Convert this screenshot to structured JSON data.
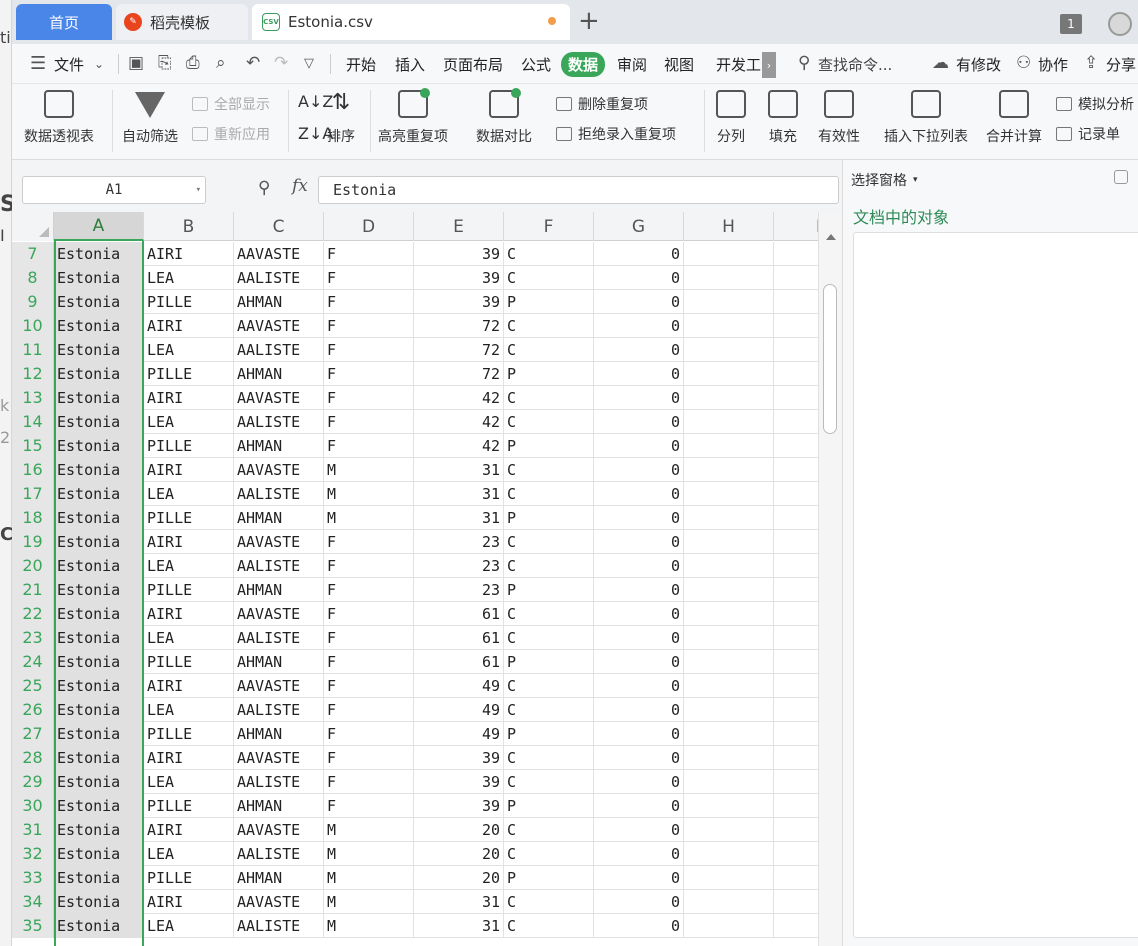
{
  "background": {
    "peek_chars": [
      "ti",
      "S",
      "I",
      "k",
      "2",
      "C"
    ]
  },
  "tabs": {
    "home": "首页",
    "template": "稻壳模板",
    "csv": "Estonia.csv",
    "csv_icon": "CSV",
    "plus": "+",
    "window_count": "1"
  },
  "menu": {
    "file": "文件",
    "items": [
      "开始",
      "插入",
      "页面布局",
      "公式",
      "数据",
      "审阅",
      "视图",
      "开发工"
    ],
    "active": "数据",
    "search": "查找命令...",
    "modified": "有修改",
    "collab": "协作",
    "share": "分享"
  },
  "ribbon": {
    "pivot": "数据透视表",
    "autofilter": "自动筛选",
    "show_all": "全部显示",
    "reapply": "重新应用",
    "sort": "排序",
    "highlight_dup": "高亮重复项",
    "compare": "数据对比",
    "remove_dup": "删除重复项",
    "reject_dup": "拒绝录入重复项",
    "split": "分列",
    "fill": "填充",
    "validity": "有效性",
    "insert_dropdown": "插入下拉列表",
    "consolidate": "合并计算",
    "whatif": "模拟分析",
    "record": "记录单"
  },
  "formula_bar": {
    "name_box": "A1",
    "fx": "fx",
    "value": "Estonia"
  },
  "columns": [
    "A",
    "B",
    "C",
    "D",
    "E",
    "F",
    "G",
    "H",
    "I"
  ],
  "rows": [
    {
      "n": "7",
      "a": "Estonia",
      "b": "AIRI",
      "c": "AAVASTE",
      "d": "F",
      "e": "39",
      "f": "C",
      "g": "0"
    },
    {
      "n": "8",
      "a": "Estonia",
      "b": "LEA",
      "c": "AALISTE",
      "d": "F",
      "e": "39",
      "f": "C",
      "g": "0"
    },
    {
      "n": "9",
      "a": "Estonia",
      "b": "PILLE",
      "c": "AHMAN",
      "d": "F",
      "e": "39",
      "f": "P",
      "g": "0"
    },
    {
      "n": "10",
      "a": "Estonia",
      "b": "AIRI",
      "c": "AAVASTE",
      "d": "F",
      "e": "72",
      "f": "C",
      "g": "0"
    },
    {
      "n": "11",
      "a": "Estonia",
      "b": "LEA",
      "c": "AALISTE",
      "d": "F",
      "e": "72",
      "f": "C",
      "g": "0"
    },
    {
      "n": "12",
      "a": "Estonia",
      "b": "PILLE",
      "c": "AHMAN",
      "d": "F",
      "e": "72",
      "f": "P",
      "g": "0"
    },
    {
      "n": "13",
      "a": "Estonia",
      "b": "AIRI",
      "c": "AAVASTE",
      "d": "F",
      "e": "42",
      "f": "C",
      "g": "0"
    },
    {
      "n": "14",
      "a": "Estonia",
      "b": "LEA",
      "c": "AALISTE",
      "d": "F",
      "e": "42",
      "f": "C",
      "g": "0"
    },
    {
      "n": "15",
      "a": "Estonia",
      "b": "PILLE",
      "c": "AHMAN",
      "d": "F",
      "e": "42",
      "f": "P",
      "g": "0"
    },
    {
      "n": "16",
      "a": "Estonia",
      "b": "AIRI",
      "c": "AAVASTE",
      "d": "M",
      "e": "31",
      "f": "C",
      "g": "0"
    },
    {
      "n": "17",
      "a": "Estonia",
      "b": "LEA",
      "c": "AALISTE",
      "d": "M",
      "e": "31",
      "f": "C",
      "g": "0"
    },
    {
      "n": "18",
      "a": "Estonia",
      "b": "PILLE",
      "c": "AHMAN",
      "d": "M",
      "e": "31",
      "f": "P",
      "g": "0"
    },
    {
      "n": "19",
      "a": "Estonia",
      "b": "AIRI",
      "c": "AAVASTE",
      "d": "F",
      "e": "23",
      "f": "C",
      "g": "0"
    },
    {
      "n": "20",
      "a": "Estonia",
      "b": "LEA",
      "c": "AALISTE",
      "d": "F",
      "e": "23",
      "f": "C",
      "g": "0"
    },
    {
      "n": "21",
      "a": "Estonia",
      "b": "PILLE",
      "c": "AHMAN",
      "d": "F",
      "e": "23",
      "f": "P",
      "g": "0"
    },
    {
      "n": "22",
      "a": "Estonia",
      "b": "AIRI",
      "c": "AAVASTE",
      "d": "F",
      "e": "61",
      "f": "C",
      "g": "0"
    },
    {
      "n": "23",
      "a": "Estonia",
      "b": "LEA",
      "c": "AALISTE",
      "d": "F",
      "e": "61",
      "f": "C",
      "g": "0"
    },
    {
      "n": "24",
      "a": "Estonia",
      "b": "PILLE",
      "c": "AHMAN",
      "d": "F",
      "e": "61",
      "f": "P",
      "g": "0"
    },
    {
      "n": "25",
      "a": "Estonia",
      "b": "AIRI",
      "c": "AAVASTE",
      "d": "F",
      "e": "49",
      "f": "C",
      "g": "0"
    },
    {
      "n": "26",
      "a": "Estonia",
      "b": "LEA",
      "c": "AALISTE",
      "d": "F",
      "e": "49",
      "f": "C",
      "g": "0"
    },
    {
      "n": "27",
      "a": "Estonia",
      "b": "PILLE",
      "c": "AHMAN",
      "d": "F",
      "e": "49",
      "f": "P",
      "g": "0"
    },
    {
      "n": "28",
      "a": "Estonia",
      "b": "AIRI",
      "c": "AAVASTE",
      "d": "F",
      "e": "39",
      "f": "C",
      "g": "0"
    },
    {
      "n": "29",
      "a": "Estonia",
      "b": "LEA",
      "c": "AALISTE",
      "d": "F",
      "e": "39",
      "f": "C",
      "g": "0"
    },
    {
      "n": "30",
      "a": "Estonia",
      "b": "PILLE",
      "c": "AHMAN",
      "d": "F",
      "e": "39",
      "f": "P",
      "g": "0"
    },
    {
      "n": "31",
      "a": "Estonia",
      "b": "AIRI",
      "c": "AAVASTE",
      "d": "M",
      "e": "20",
      "f": "C",
      "g": "0"
    },
    {
      "n": "32",
      "a": "Estonia",
      "b": "LEA",
      "c": "AALISTE",
      "d": "M",
      "e": "20",
      "f": "C",
      "g": "0"
    },
    {
      "n": "33",
      "a": "Estonia",
      "b": "PILLE",
      "c": "AHMAN",
      "d": "M",
      "e": "20",
      "f": "P",
      "g": "0"
    },
    {
      "n": "34",
      "a": "Estonia",
      "b": "AIRI",
      "c": "AAVASTE",
      "d": "M",
      "e": "31",
      "f": "C",
      "g": "0"
    },
    {
      "n": "35",
      "a": "Estonia",
      "b": "LEA",
      "c": "AALISTE",
      "d": "M",
      "e": "31",
      "f": "C",
      "g": "0"
    }
  ],
  "panel": {
    "title": "选择窗格",
    "subtitle": "文档中的对象"
  },
  "colors": {
    "accent_green": "#3aa65a",
    "home_tab_blue": "#4a86e8"
  }
}
